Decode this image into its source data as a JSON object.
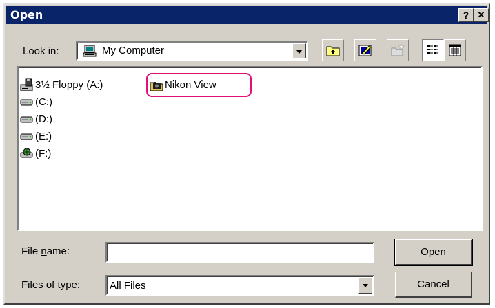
{
  "window": {
    "title": "Open",
    "help_label": "?",
    "close_label": "✕"
  },
  "look_in": {
    "label": "Look in:",
    "value": "My Computer"
  },
  "toolbar": {
    "icons": [
      "up-one-level-icon",
      "desktop-icon",
      "new-folder-icon",
      "list-view-icon",
      "details-view-icon"
    ]
  },
  "files": [
    {
      "label": "3½ Floppy (A:)",
      "icon": "floppy-drive-icon"
    },
    {
      "label": "(C:)",
      "icon": "hard-drive-icon"
    },
    {
      "label": "(D:)",
      "icon": "hard-drive-icon"
    },
    {
      "label": "(E:)",
      "icon": "hard-drive-icon"
    },
    {
      "label": "(F:)",
      "icon": "network-drive-icon"
    },
    {
      "label": "Nikon View",
      "icon": "camera-folder-icon"
    }
  ],
  "file_name": {
    "label_prefix": "File ",
    "label_key": "n",
    "label_suffix": "ame:",
    "value": ""
  },
  "file_type": {
    "label_prefix": "Files of ",
    "label_key": "t",
    "label_suffix": "ype:",
    "value": "All Files"
  },
  "buttons": {
    "open_key": "O",
    "open_rest": "pen",
    "cancel": "Cancel"
  },
  "colors": {
    "titlebar": "#0a246a",
    "highlight": "#e0127a"
  }
}
